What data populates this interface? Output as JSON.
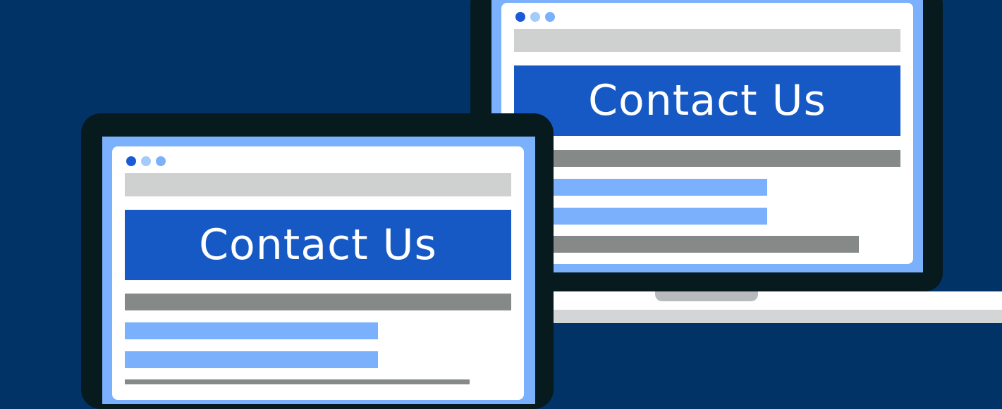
{
  "laptop": {
    "hero_text": "Contact Us"
  },
  "tablet": {
    "hero_text": "Contact Us"
  }
}
